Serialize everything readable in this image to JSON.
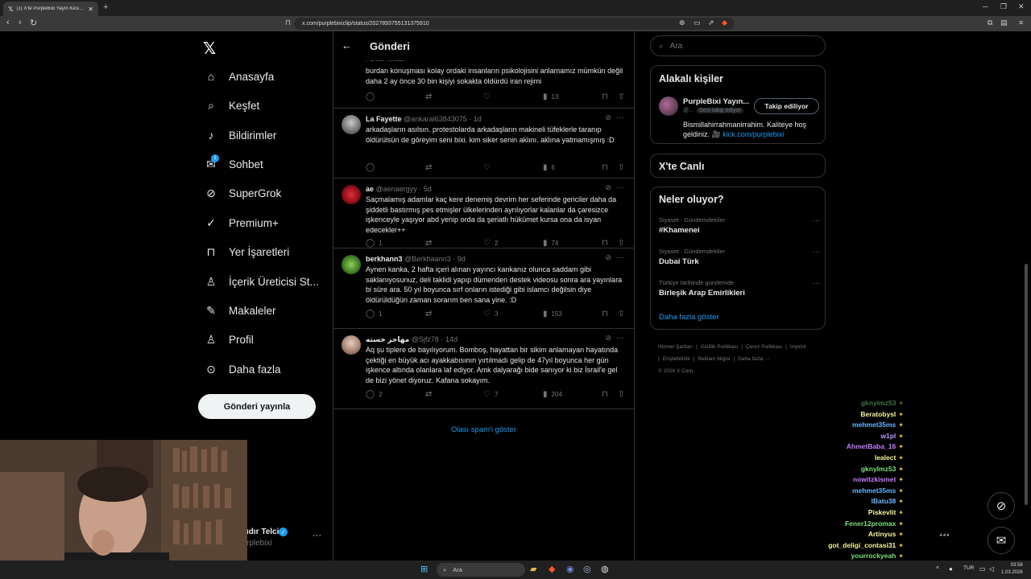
{
  "browser": {
    "tab_title": "(1) X'te PurpleBixi Yayın Kesitleri",
    "url": "x.com/purplebixiclip/status/2027893755131375910"
  },
  "sidebar": {
    "items": [
      {
        "label": "Anasayfa",
        "icon": "home-icon"
      },
      {
        "label": "Keşfet",
        "icon": "search-icon"
      },
      {
        "label": "Bildirimler",
        "icon": "bell-icon"
      },
      {
        "label": "Sohbet",
        "icon": "mail-icon",
        "badge": "1"
      },
      {
        "label": "SuperGrok",
        "icon": "grok-icon"
      },
      {
        "label": "Premium+",
        "icon": "verified-icon"
      },
      {
        "label": "Yer İşaretleri",
        "icon": "bookmark-icon"
      },
      {
        "label": "İçerik Üreticisi St...",
        "icon": "creator-icon"
      },
      {
        "label": "Makaleler",
        "icon": "article-icon"
      },
      {
        "label": "Profil",
        "icon": "person-icon"
      },
      {
        "label": "Daha fazla",
        "icon": "more-circle-icon"
      }
    ],
    "post_button": "Gönderi yayınla",
    "profile_name": "ıdır Telci",
    "profile_handle": "rplebixi"
  },
  "main": {
    "title": "Gönderi",
    "top_partial": {
      "label": "Parodi hesabı",
      "text": "burdan konuşması kolay ordaki insanların psikolojisini anlamamız mümkün değil daha 2 ay önce 30 bin kişiyi sokakta öldürdü iran rejimi",
      "views": "13"
    },
    "replies": [
      {
        "name": "La Fayette",
        "handle": "@ankaral63843075",
        "time": "1d",
        "text": "arkadaşların asılsın. protestolarda arkadaşların makineli tüfeklerle taranıp öldürülsün de göreyim seni bixi. kim siker senin aklını. aklına yatmamışmış :D",
        "replies": "",
        "likes": "",
        "views": "6"
      },
      {
        "name": "ae",
        "handle": "@aenaergyy",
        "time": "5d",
        "text": "Saçmalamış adamlar kaç kere denemiş devrim her seferinde gericiler daha da şiddetli bastırmış pes etmişler ülkelerinden ayrılıyorlar kalanlar da çaresizce işkenceyle yaşıyor abd yenip orda da şeriatlı hükümet kursa ona da isyan edecekler++",
        "replies": "1",
        "likes": "2",
        "views": "74"
      },
      {
        "name": "berkhann3",
        "handle": "@Berkhaann3",
        "time": "9d",
        "text": "Aynen kanka, 2 hafta içeri alınan yayıncı kankanız olunca saddam gibi saklanıyosunuz, deli taklidi yapıp dümenden destek videosu sonra ara yayınlara bi süre ara. 50 yıl boyunca sırf onların istediği gibi islamcı değilsin diye öldürüldüğün zaman sorarım ben sana yine. :D",
        "replies": "1",
        "likes": "3",
        "views": "153"
      },
      {
        "name": "مهاجر خسته",
        "handle": "@Sjfz78",
        "time": "14d",
        "text": "Aq şu tiplere de bayılıyorum. Bomboş, hayattan bir sikim anlamayan hayatında çektiği en büyük acı ayakkabısının yırtılmadı gelip de 47yıl boyunca her gün işkence altında olanlara laf ediyor. Amk dalyarağı bide sanıyor ki biz İsrail'e gel de bizi yönet diyoruz. Kafana sokayım.",
        "replies": "2",
        "likes": "7",
        "views": "204"
      }
    ],
    "spam_link": "Olası spam'i göster"
  },
  "right": {
    "search_placeholder": "Ara",
    "related_title": "Alakalı kişiler",
    "related_person": {
      "name": "PurpleBixi Yayın...",
      "handle": "@...",
      "follows_you": "Seni takip ediyor",
      "button": "Takip ediliyor",
      "bio": "Bismillahirrahmanirrahim. Kaliteye hoş geldiniz. 🎥",
      "bio_link": "kick.com/purplebixi"
    },
    "live_title": "X'te Canlı",
    "trends_title": "Neler oluyor?",
    "trends": [
      {
        "meta": "Siyaset · Gündemdekiler",
        "title": "#Khamenei"
      },
      {
        "meta": "Siyaset · Gündemdekiler",
        "title": "Dubai Türk"
      },
      {
        "meta": "Türkiye tarihinde gündemde",
        "title": "Birleşik Arap Emirlikleri"
      }
    ],
    "show_more": "Daha fazla göster",
    "footer": [
      "Hizmet Şartları",
      "|",
      "Gizlilik Politikası",
      "|",
      "Çerez Politikası",
      "|",
      "Imprint",
      "|",
      "Erişilebilirlik",
      "|",
      "Reklam bilgisi",
      "|",
      "Daha fazla ···",
      "© 2026 X Corp."
    ]
  },
  "chat": [
    {
      "user": "gknylmz53",
      "color": "#7ee081"
    },
    {
      "user": "Beratobysl",
      "color": "#f5f5a0"
    },
    {
      "user": "mehmet35ms",
      "color": "#6ab7ff"
    },
    {
      "user": "w1pl",
      "color": "#b59cff"
    },
    {
      "user": "AhmetBaba_16",
      "color": "#c77dff"
    },
    {
      "user": "lealect",
      "color": "#f5f5a0"
    },
    {
      "user": "gknylmz53",
      "color": "#7ee081"
    },
    {
      "user": "nowitzkismet",
      "color": "#c77dff"
    },
    {
      "user": "mehmet35ms",
      "color": "#6ab7ff"
    },
    {
      "user": "lBatu38",
      "color": "#6ab7ff"
    },
    {
      "user": "Piskevlit",
      "color": "#f5f5a0"
    },
    {
      "user": "Fener12promax",
      "color": "#7ee081"
    },
    {
      "user": "Artinyus",
      "color": "#f5f5a0"
    },
    {
      "user": "got_deligi_contasi31",
      "color": "#f5f5a0"
    },
    {
      "user": "yourrockyeah",
      "color": "#7ee081"
    }
  ],
  "taskbar": {
    "search": "Ara",
    "lang": "TUR",
    "time": "03:58",
    "date": "1.03.2026"
  }
}
